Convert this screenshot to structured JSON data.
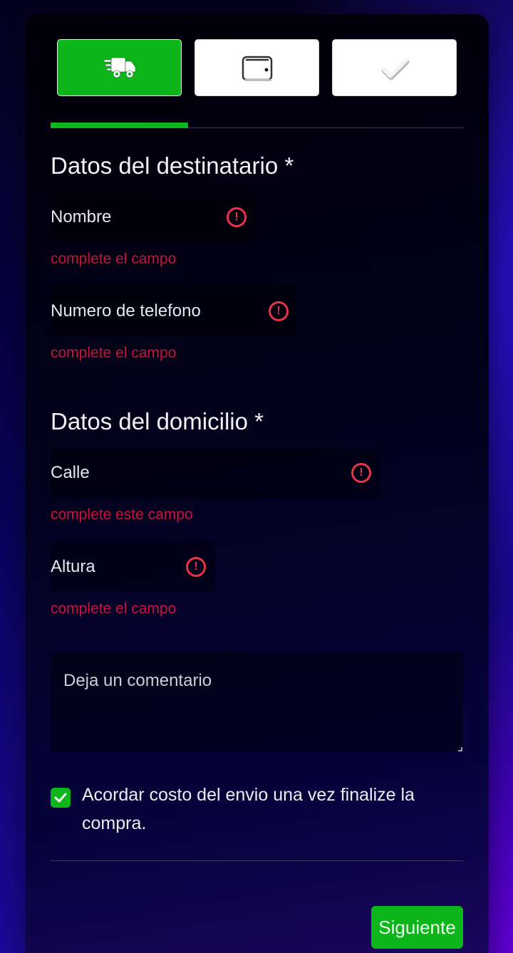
{
  "steps": [
    {
      "icon": "delivery-truck-icon",
      "state": "active"
    },
    {
      "icon": "wallet-icon",
      "state": "inactive"
    },
    {
      "icon": "checkmark-icon",
      "state": "inactive"
    }
  ],
  "progress": {
    "value": 0.333
  },
  "recipient": {
    "title": "Datos del destinatario *",
    "name_label": "Nombre",
    "name_error": "complete el campo",
    "phone_label": "Numero de telefono",
    "phone_error": "complete el campo"
  },
  "address": {
    "title": "Datos del domicilio *",
    "street_label": "Calle",
    "street_error": "complete este campo",
    "number_label": "Altura",
    "number_error": "complete el campo"
  },
  "comment": {
    "placeholder": "Deja un comentario"
  },
  "shipping_agreement": {
    "checked": true,
    "label": "Acordar costo del envio una vez finalize la compra."
  },
  "actions": {
    "next_label": "Siguiente"
  },
  "colors": {
    "accent": "#0bb51a",
    "error": "#e8344a",
    "error_text": "#c8133a"
  }
}
